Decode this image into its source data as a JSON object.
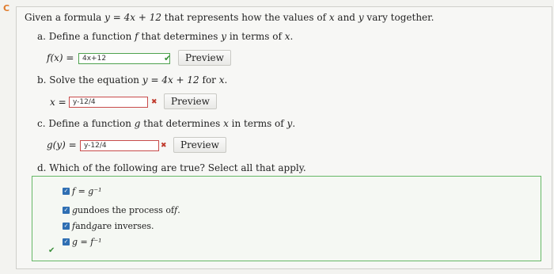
{
  "question": {
    "intro_prefix": "Given a formula ",
    "formula": "y = 4x + 12",
    "intro_suffix": " that represents how the values of ",
    "var_x": "x",
    "and": " and ",
    "var_y": "y",
    "intro_end": " vary together."
  },
  "part_a": {
    "prefix": "a. Define a function ",
    "fname": "f",
    "middle": " that determines ",
    "yvar": "y",
    "middle2": " in terms of ",
    "xvar": "x",
    "end": ".",
    "row_label": "f(x) =",
    "answer": "4x+12",
    "status": "correct",
    "preview": "Preview"
  },
  "part_b": {
    "prefix": "b. Solve the equation ",
    "equation": "y = 4x + 12",
    "middle": " for ",
    "xvar": "x",
    "end": ".",
    "row_label": "x =",
    "answer": "y-12/4",
    "status": "wrong",
    "preview": "Preview"
  },
  "part_c": {
    "prefix": "c. Define a function ",
    "gname": "g",
    "middle": " that determines ",
    "xvar": "x",
    "middle2": " in terms of ",
    "yvar": "y",
    "end": ".",
    "row_label": "g(y) =",
    "answer": "y-12/4",
    "status": "wrong",
    "preview": "Preview"
  },
  "part_d": {
    "prompt": "d. Which of the following are true? Select all that apply.",
    "choices": [
      {
        "text": "f = g⁻¹",
        "checked": true
      },
      {
        "text_math": "g",
        "text": " undoes the process of ",
        "text_math2": "f",
        "text_end": ".",
        "checked": true
      },
      {
        "text_math": "f",
        "text": " and ",
        "text_math2": "g",
        "text_end": " are inverses.",
        "checked": true
      },
      {
        "text": "g = f⁻¹",
        "checked": true
      }
    ]
  },
  "icons": {
    "edge": "refresh-icon",
    "correct": "checkmark-icon",
    "wrong": "x-mark-icon"
  },
  "colors": {
    "correct": "#4ea24e",
    "wrong": "#c84b4b",
    "checkbox": "#2f6fb3"
  }
}
